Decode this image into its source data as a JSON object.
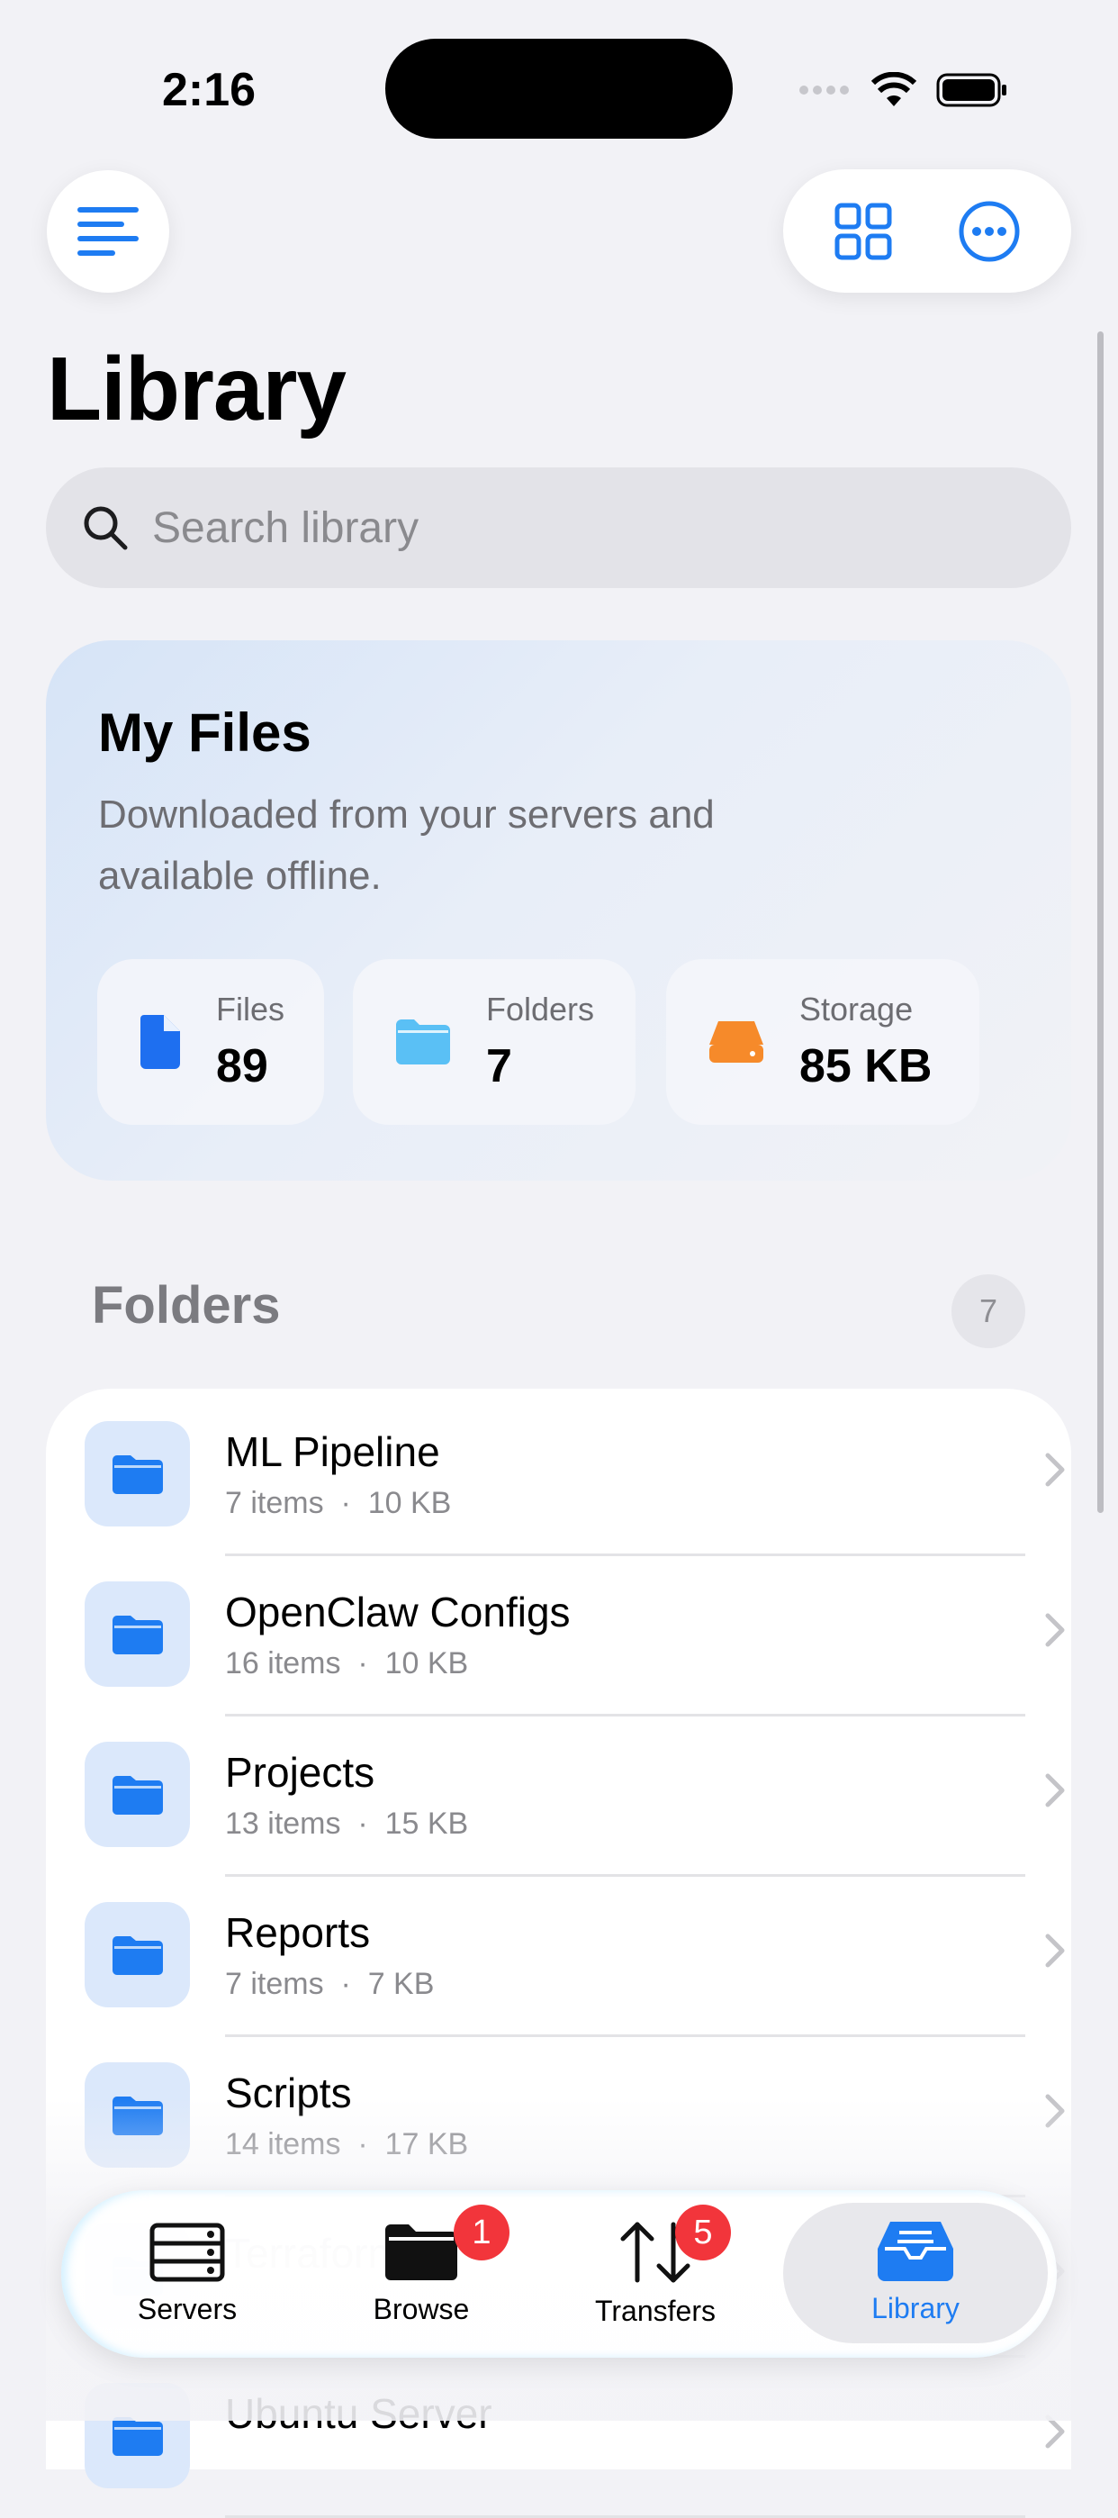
{
  "status_bar": {
    "time": "2:16"
  },
  "header": {
    "title": "Library"
  },
  "search": {
    "placeholder": "Search library"
  },
  "my_files": {
    "title": "My Files",
    "description": "Downloaded from your servers and available offline.",
    "stats": [
      {
        "label": "Files",
        "value": "89",
        "icon": "file-icon",
        "color": "#1e6ff0"
      },
      {
        "label": "Folders",
        "value": "7",
        "icon": "folder-icon",
        "color": "#5ac0f5"
      },
      {
        "label": "Storage",
        "value": "85 KB",
        "icon": "drive-icon",
        "color": "#f68a2a"
      }
    ]
  },
  "folders": {
    "title": "Folders",
    "count": "7",
    "items": [
      {
        "name": "ML Pipeline",
        "items": "7 items",
        "size": "10 KB"
      },
      {
        "name": "OpenClaw Configs",
        "items": "16 items",
        "size": "10 KB"
      },
      {
        "name": "Projects",
        "items": "13 items",
        "size": "15 KB"
      },
      {
        "name": "Reports",
        "items": "7 items",
        "size": "7 KB"
      },
      {
        "name": "Scripts",
        "items": "14 items",
        "size": "17 KB"
      },
      {
        "name": "Terraform",
        "items": "",
        "size": ""
      },
      {
        "name": "Ubuntu Server",
        "items": "",
        "size": ""
      }
    ]
  },
  "tabs": [
    {
      "label": "Servers"
    },
    {
      "label": "Browse",
      "badge": "1"
    },
    {
      "label": "Transfers",
      "badge": "5"
    },
    {
      "label": "Library",
      "active": true
    }
  ],
  "colors": {
    "accent": "#1e7cf2",
    "badge": "#f2353b"
  }
}
